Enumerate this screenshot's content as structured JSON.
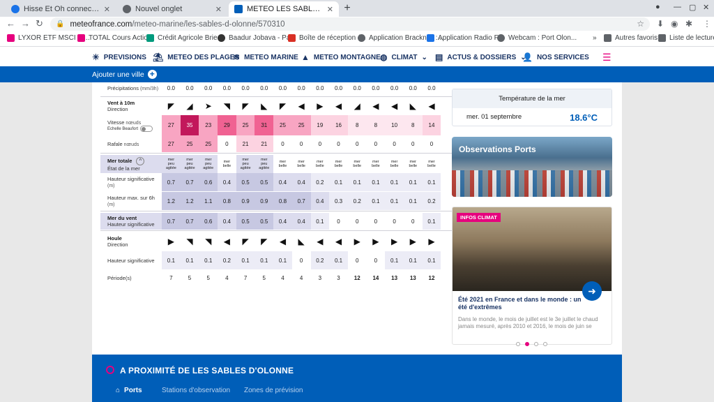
{
  "browser": {
    "tabs": [
      {
        "label": "Hisse Et Oh connecte tous les jo",
        "icon": "hisse-icon",
        "color": "#1a73e8"
      },
      {
        "label": "Nouvel onglet",
        "icon": "chrome-icon",
        "color": "#5f6368"
      },
      {
        "label": "METEO LES SABLES D'OLONNE",
        "icon": "meteofrance-icon",
        "color": "#005eb8"
      }
    ],
    "url_host": "meteofrance.com",
    "url_path": "/meteo-marine/les-sables-d-olonne/570310",
    "bookmarks": [
      {
        "label": "LYXOR ETF MSCI W...",
        "color": "#e6007e"
      },
      {
        "label": "TOTAL Cours Actio...",
        "color": "#e6007e"
      },
      {
        "label": "Crédit Agricole Brie...",
        "color": "#009a7d"
      },
      {
        "label": "Baadur Jobava - Pa...",
        "color": "#333333"
      },
      {
        "label": "Boîte de réception (...",
        "color": "#d93025"
      },
      {
        "label": "Application Bracknell :...",
        "color": "#5f6368"
      },
      {
        "label": "Application Radio F...",
        "color": "#1a73e8"
      },
      {
        "label": "Webcam : Port Olon...",
        "color": "#5f6368"
      },
      {
        "label": "Autres favoris",
        "color": "#5f6368"
      },
      {
        "label": "Liste de lecture",
        "color": "#5f6368"
      }
    ]
  },
  "site": {
    "nav": [
      {
        "label": "PREVISIONS",
        "icon": "forecast-icon"
      },
      {
        "label": "METEO DES PLAGES",
        "icon": "beach-icon"
      },
      {
        "label": "METEO MARINE",
        "icon": "waves-icon"
      },
      {
        "label": "METEO MONTAGNE",
        "icon": "mountain-icon"
      },
      {
        "label": "CLIMAT",
        "icon": "globe-icon"
      },
      {
        "label": "ACTUS & DOSSIERS",
        "icon": "news-icon"
      },
      {
        "label": "NOS SERVICES",
        "icon": "user-plus-icon"
      }
    ],
    "add_city": "Ajouter une ville",
    "brand_color": "#005eb8",
    "accent_color": "#e6007e"
  },
  "table": {
    "precip": {
      "label": "Précipitations",
      "unit": "(mm/3h)",
      "values": [
        "0.0",
        "0.0",
        "0.0",
        "0.0",
        "0.0",
        "0.0",
        "0.0",
        "0.0",
        "0.0",
        "0.0",
        "0.0",
        "0.0",
        "0.0",
        "0.0",
        "0.0"
      ]
    },
    "wind_dir": {
      "label": "Vent à 10m",
      "sub": "Direction",
      "arrows": [
        "◤",
        "◢",
        "➤",
        "◥",
        "◤",
        "◣",
        "◤",
        "◀",
        "▶",
        "◀",
        "◢",
        "◀",
        "◀",
        "◣",
        "◀"
      ]
    },
    "wind_speed": {
      "label": "Vitesse",
      "unit": "nœuds",
      "toggle_label": "Echelle Beaufort",
      "values": [
        "27",
        "35",
        "23",
        "29",
        "25",
        "31",
        "25",
        "25",
        "19",
        "16",
        "8",
        "8",
        "10",
        "8",
        "14"
      ]
    },
    "gust": {
      "label": "Rafale",
      "unit": "nœuds",
      "values": [
        "27",
        "25",
        "25",
        "0",
        "21",
        "21",
        "0",
        "0",
        "0",
        "0",
        "0",
        "0",
        "0",
        "0",
        "0"
      ]
    },
    "sea_total": {
      "label": "Mer totale",
      "sub": "État de la mer",
      "values": [
        "mer peu agitée",
        "mer peu agitée",
        "mer peu agitée",
        "mer belle",
        "mer peu agitée",
        "mer peu agitée",
        "mer belle",
        "mer belle",
        "mer belle",
        "mer belle",
        "mer belle",
        "mer belle",
        "mer belle",
        "mer belle",
        "mer belle"
      ]
    },
    "hs": {
      "label": "Hauteur significative",
      "unit": "(m)",
      "values": [
        "0.7",
        "0.7",
        "0.6",
        "0.4",
        "0.5",
        "0.5",
        "0.4",
        "0.4",
        "0.2",
        "0.1",
        "0.1",
        "0.1",
        "0.1",
        "0.1",
        "0.1"
      ]
    },
    "hmax": {
      "label": "Hauteur max. sur 6h",
      "unit": "(m)",
      "values": [
        "1.2",
        "1.2",
        "1.1",
        "0.8",
        "0.9",
        "0.9",
        "0.8",
        "0.7",
        "0.4",
        "0.3",
        "0.2",
        "0.1",
        "0.1",
        "0.1",
        "0.2"
      ]
    },
    "windsea": {
      "label": "Mer du vent",
      "sub": "Hauteur significative",
      "values": [
        "0.7",
        "0.7",
        "0.6",
        "0.4",
        "0.5",
        "0.5",
        "0.4",
        "0.4",
        "0.1",
        "0",
        "0",
        "0",
        "0",
        "0",
        "0.1"
      ]
    },
    "swell_dir": {
      "label": "Houle",
      "sub": "Direction",
      "arrows": [
        "▶",
        "◥",
        "◥",
        "◀",
        "◤",
        "◤",
        "◀",
        "◣",
        "◀",
        "◀",
        "▶",
        "▶",
        "▶",
        "▶",
        "▶"
      ]
    },
    "swell_h": {
      "label": "Hauteur significative",
      "values": [
        "0.1",
        "0.1",
        "0.1",
        "0.2",
        "0.1",
        "0.1",
        "0.1",
        "0",
        "0.2",
        "0.1",
        "0",
        "0",
        "0.1",
        "0.1",
        "0.1"
      ]
    },
    "period": {
      "label": "Période(s)",
      "values": [
        "7",
        "5",
        "5",
        "4",
        "7",
        "5",
        "4",
        "4",
        "3",
        "3",
        "12",
        "14",
        "13",
        "13",
        "12"
      ]
    }
  },
  "sea_temp": {
    "title": "Température de la mer",
    "date": "mer. 01 septembre",
    "value": "18.6°C"
  },
  "ports_card": {
    "title": "Observations Ports"
  },
  "climat_card": {
    "badge": "INFOS CLIMAT",
    "title": "Été 2021 en France et dans le monde : un été d'extrêmes",
    "desc": "Dans le monde, le mois de juillet est le 3e juillet le chaud jamais mesuré, après 2010 et 2016, le mois de juin se"
  },
  "nearby": {
    "title": "A PROXIMITÉ DE LES SABLES D'OLONNE",
    "tabs": [
      "Ports",
      "Stations d'observation",
      "Zones de prévision"
    ]
  }
}
